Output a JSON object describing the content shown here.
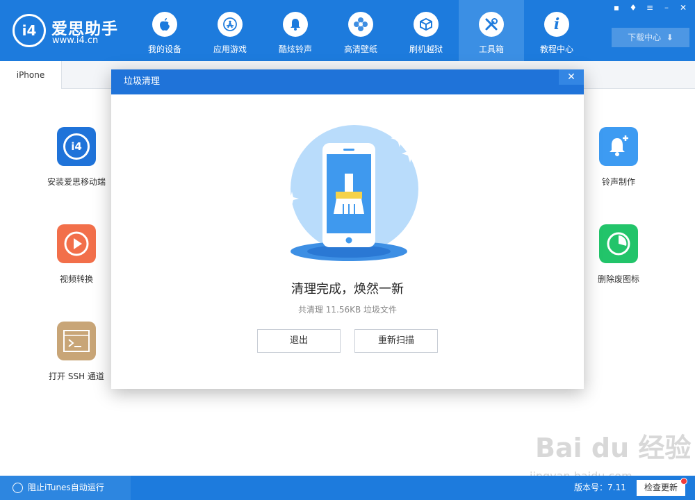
{
  "app": {
    "logo_mark": "i4",
    "name": "爱思助手",
    "url": "www.i4.cn"
  },
  "nav": [
    {
      "label": "我的设备",
      "icon": "apple-icon"
    },
    {
      "label": "应用游戏",
      "icon": "app-store-icon"
    },
    {
      "label": "酷炫铃声",
      "icon": "bell-icon"
    },
    {
      "label": "高清壁纸",
      "icon": "flower-icon"
    },
    {
      "label": "刷机越狱",
      "icon": "box-icon"
    },
    {
      "label": "工具箱",
      "icon": "tools-icon",
      "active": true
    },
    {
      "label": "教程中心",
      "icon": "info-icon"
    }
  ],
  "window_controls": [
    "feedback-icon",
    "skin-icon",
    "menu-icon",
    "minimize-icon",
    "close-icon"
  ],
  "download_center": "下载中心",
  "tab": {
    "label": "iPhone"
  },
  "tools_left": [
    {
      "label": "安装爱思移动端",
      "icon": "i4-app-icon",
      "color": "#1f73d9"
    },
    {
      "label": "视频转换",
      "icon": "play-icon",
      "color": "#f26f4a"
    },
    {
      "label": "打开 SSH 通道",
      "icon": "terminal-icon",
      "color": "#c8a577"
    }
  ],
  "tools_right": [
    {
      "label": "铃声制作",
      "icon": "bell-plus-icon",
      "color": "#3d9bf2"
    },
    {
      "label": "删除废图标",
      "icon": "pie-icon",
      "color": "#22c46a"
    }
  ],
  "dialog": {
    "title": "垃圾清理",
    "done_title": "清理完成，焕然一新",
    "summary": "共清理 11.56KB 垃圾文件",
    "exit_label": "退出",
    "rescan_label": "重新扫描"
  },
  "status": {
    "block_itunes": "阻止iTunes自动运行",
    "version": "版本号：7.11",
    "check_update": "检查更新"
  },
  "watermark": {
    "text": "Bai du 经验",
    "url": "jingyan.baidu.com"
  },
  "colors": {
    "header": "#1d7bdd",
    "accent": "#1f73d9",
    "illustration_circle": "#b9dcfb"
  }
}
